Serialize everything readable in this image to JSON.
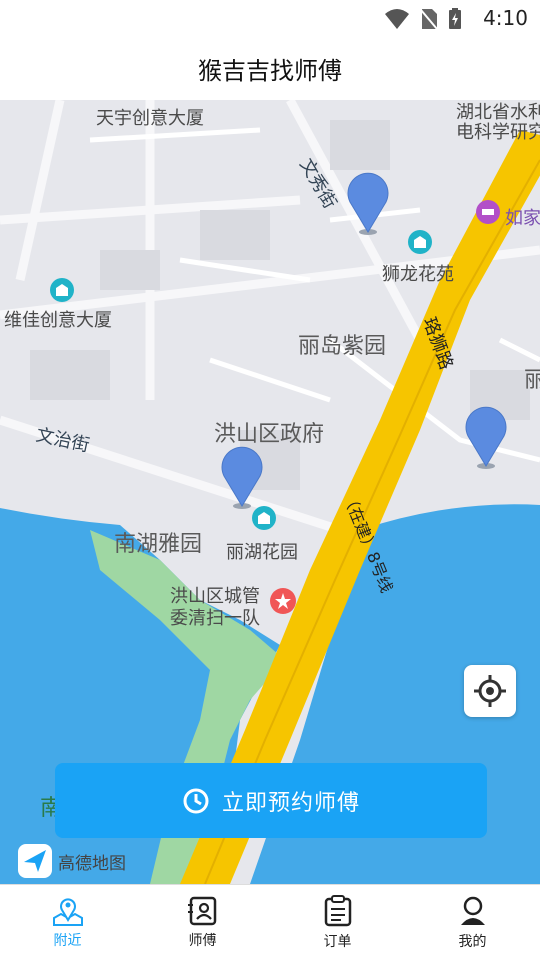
{
  "status": {
    "time": "4:10"
  },
  "header": {
    "title": "猴吉吉找师傅"
  },
  "map": {
    "labels": {
      "tianyu": "天宇创意大厦",
      "hubei": "湖北省水利",
      "hubei2": "电科学研究",
      "wenxiu": "文秀街",
      "rujia": "如家",
      "shilong": "狮龙花苑",
      "weijia": "维佳创意大厦",
      "luoshi": "珞狮路",
      "lidao": "丽岛紫园",
      "li_edge": "丽",
      "hongshan_gov": "洪山区政府",
      "wenzhi": "文治街",
      "nanhu": "南湖雅园",
      "lihu": "丽湖花园",
      "chengguan": "洪山区城管",
      "chengguan2": "委清扫一队",
      "expressway": "（在建）8号线",
      "south_edge": "南"
    },
    "logo_text": "高德地图"
  },
  "action": {
    "book_label": "立即预约师傅"
  },
  "tabs": [
    {
      "label": "附近",
      "icon": "nearby-map-icon",
      "active": true
    },
    {
      "label": "师傅",
      "icon": "master-card-icon",
      "active": false
    },
    {
      "label": "订单",
      "icon": "order-clipboard-icon",
      "active": false
    },
    {
      "label": "我的",
      "icon": "profile-icon",
      "active": false
    }
  ],
  "colors": {
    "accent": "#1aa3f5",
    "water": "#44a9e8",
    "road": "#f6c500",
    "pin": "#5b8be0"
  }
}
